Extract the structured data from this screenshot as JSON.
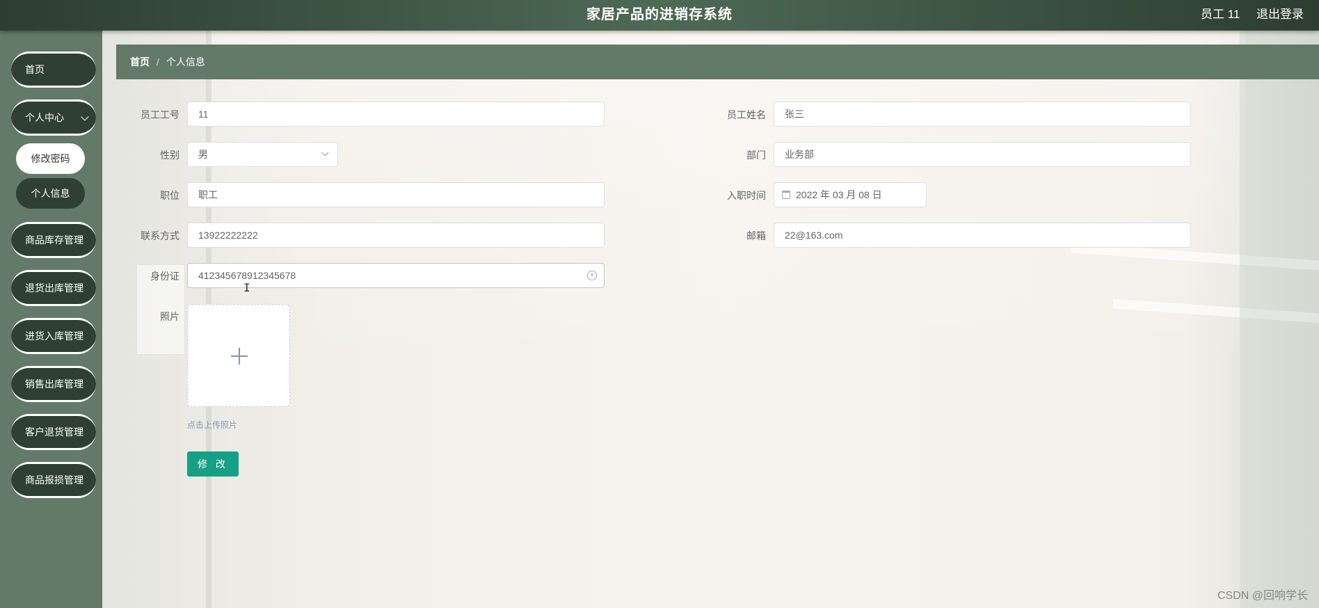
{
  "header": {
    "title": "家居产品的进销存系统",
    "user": "员工 11",
    "logout": "退出登录"
  },
  "sidebar": {
    "home": "首页",
    "personal_center": "个人中心",
    "sub_items": [
      "修改密码",
      "个人信息"
    ],
    "items": [
      "商品库存管理",
      "退货出库管理",
      "进货入库管理",
      "销售出库管理",
      "客户退货管理",
      "商品报损管理"
    ]
  },
  "breadcrumb": {
    "home": "首页",
    "separator": "/",
    "current": "个人信息"
  },
  "form": {
    "employee_no": {
      "label": "员工工号",
      "value": "11"
    },
    "employee_name": {
      "label": "员工姓名",
      "value": "张三"
    },
    "gender": {
      "label": "性别",
      "value": "男"
    },
    "department": {
      "label": "部门",
      "value": "业务部"
    },
    "position": {
      "label": "职位",
      "value": "职工"
    },
    "hire_date": {
      "label": "入职时间",
      "value": "2022 年 03 月 08 日"
    },
    "phone": {
      "label": "联系方式",
      "value": "13922222222"
    },
    "email": {
      "label": "邮箱",
      "value": "22@163.com"
    },
    "id_card": {
      "label": "身份证",
      "value": "412345678912345678"
    },
    "photo": {
      "label": "照片",
      "tip": "点击上传照片"
    },
    "submit_label": "修 改"
  },
  "watermark": "CSDN @回响学长",
  "colors": {
    "header": "#3f5344",
    "sidebar": "#627a67",
    "menu_button": "#2f4032",
    "submit": "#16a085"
  }
}
